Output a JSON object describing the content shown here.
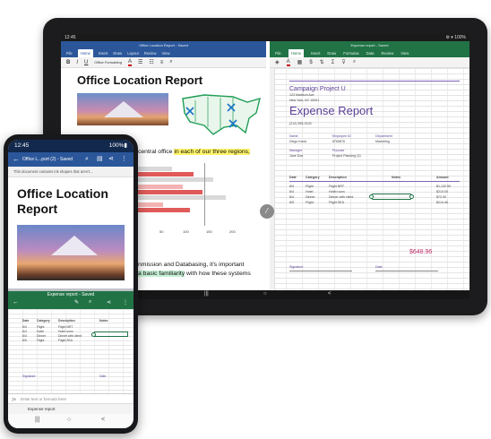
{
  "tablet": {
    "status_time": "12:45",
    "status_right": "⚙ ▾ 100%",
    "word": {
      "window_title": "Office Location Report - Saved",
      "tabs": [
        "File",
        "Home",
        "Insert",
        "Draw",
        "Layout",
        "Review",
        "View"
      ],
      "font_style": "Office Formatting",
      "doc_title": "Office Location Report",
      "text_line1_pre": "central office ",
      "text_line1_hl": "in each of our three regions,",
      "bar_axis": [
        "0",
        "50",
        "100",
        "150",
        "200"
      ],
      "text_line2": "nmission and Databasing, it's important",
      "text_line3_hl": "a basic familiarity",
      "text_line3_post": " with how these systems"
    },
    "excel": {
      "window_title": "Expense report - Saved",
      "tabs": [
        "File",
        "Home",
        "Insert",
        "Draw",
        "Formulas",
        "Data",
        "Review",
        "View"
      ],
      "campaign_title": "Campaign Project U",
      "heading": "Expense Report",
      "addr": [
        "123 Madison Ave",
        "New York, NY 10001",
        "(212) 555-0100"
      ],
      "info_labels": [
        "Name",
        "Employee ID",
        "Department",
        "Manager",
        "Purpose"
      ],
      "info_values": [
        "Diego Kwok",
        "8765876",
        "Marketing",
        "Jane Doe",
        "Project Planning Q1"
      ],
      "columns": [
        "Date",
        "Category",
        "Description",
        "Notes",
        "Amount"
      ],
      "rows": [
        [
          "8/4",
          "Flight",
          "Flight NRT",
          "$1,132.50"
        ],
        [
          "8/4",
          "Hotel",
          "Hotel room",
          "$210.00"
        ],
        [
          "8/4",
          "Dinner",
          "Dinner with client",
          "$72.00"
        ],
        [
          "8/5",
          "Flight",
          "Flight SEA",
          "$214.46"
        ]
      ],
      "total": "$648.96",
      "signature_label": "Signature",
      "date_label": "Date"
    },
    "nav": [
      "|||",
      "○",
      "<"
    ]
  },
  "phone": {
    "status_time": "12:45",
    "status_right": "100%▮",
    "word_title": "Office L...port (2) - Saved",
    "notice": "This document contains ink shapes that aren't...",
    "doc_title": "Office Location Report",
    "excel_title": "Expense report - Saved",
    "columns": [
      "Date",
      "Category",
      "Description",
      "Notes"
    ],
    "rows": [
      [
        "8/4",
        "Flight",
        "Flight NRT"
      ],
      [
        "8/4",
        "Hotel",
        "Hotel room"
      ],
      [
        "8/4",
        "Dinner",
        "Dinner with client"
      ],
      [
        "8/5",
        "Flight",
        "Flight SEA"
      ]
    ],
    "signature_label": "Signature",
    "date_label": "Date",
    "formula_placeholder": "Enter text or formula here",
    "sheet_tab": "Expense report",
    "nav": [
      "|||",
      "○",
      "<"
    ]
  },
  "colors": {
    "word_blue": "#2b579a",
    "excel_green": "#217346",
    "accent_purple": "#5b3e96",
    "total_pink": "#c0306b"
  }
}
